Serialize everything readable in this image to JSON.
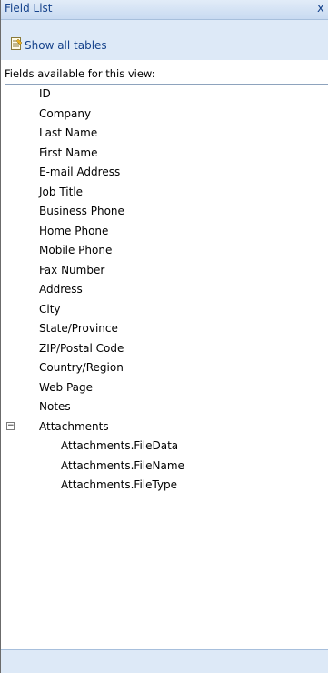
{
  "panel": {
    "title": "Field List",
    "close_glyph": "x"
  },
  "toolbar": {
    "show_all_tables": "Show all tables",
    "icon": "table-edit-icon"
  },
  "fields_label": "Fields available for this view:",
  "fields": [
    "ID",
    "Company",
    "Last Name",
    "First Name",
    "E-mail Address",
    "Job Title",
    "Business Phone",
    "Home Phone",
    "Mobile Phone",
    "Fax Number",
    "Address",
    "City",
    "State/Province",
    "ZIP/Postal Code",
    "Country/Region",
    "Web Page",
    "Notes",
    "Attachments"
  ],
  "attachments_children": [
    "Attachments.FileData",
    "Attachments.FileName",
    "Attachments.FileType"
  ],
  "expander_glyph": "−",
  "colors": {
    "header_bg": "#d4e2f4",
    "link": "#15428b"
  }
}
